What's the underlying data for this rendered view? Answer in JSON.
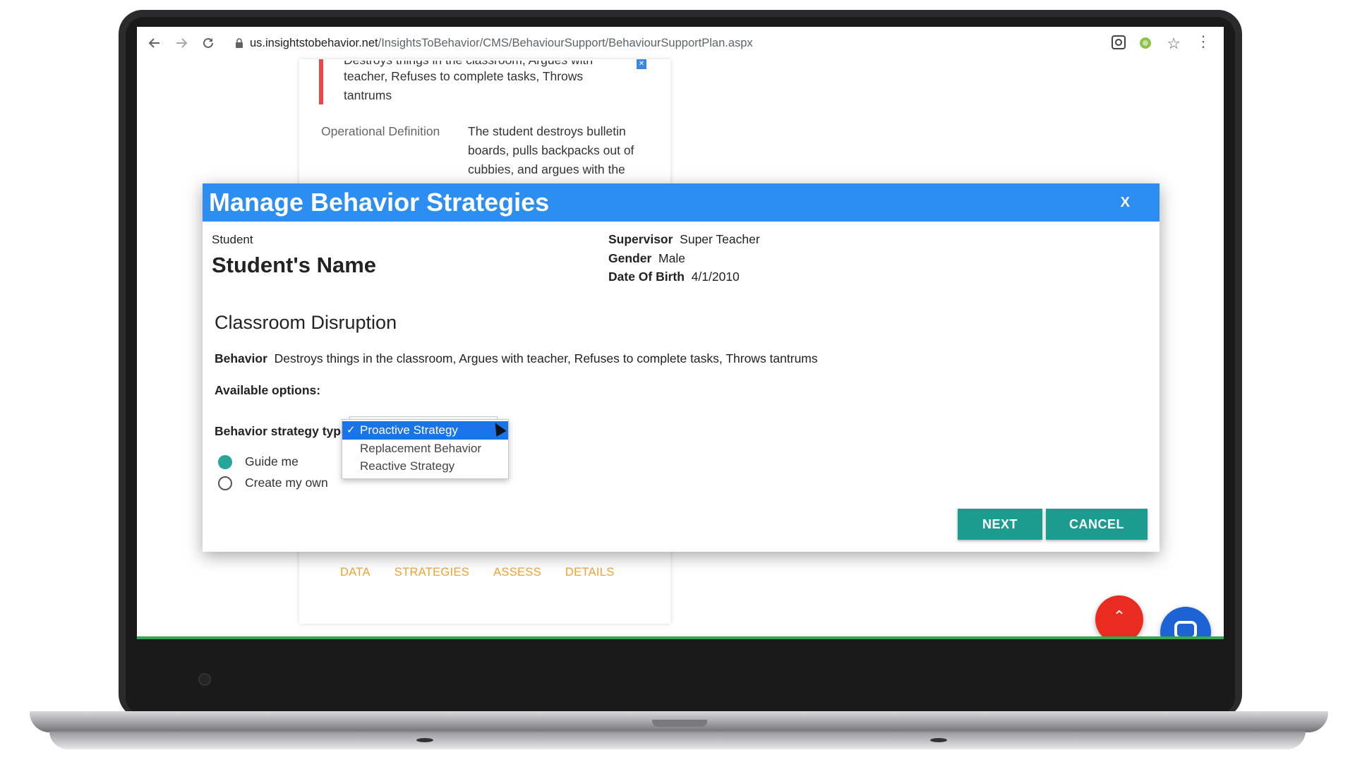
{
  "browser": {
    "url_host": "us.insightstobehavior.net",
    "url_path": "/InsightsToBehavior/CMS/BehaviourSupport/BehaviourSupportPlan.aspx"
  },
  "background_page": {
    "behavior_text_top": "Destroys things in the classroom, Argues with",
    "behavior_text_line2": "teacher, Refuses to complete tasks, Throws",
    "behavior_text_line3": "tantrums",
    "operational_definition_label": "Operational Definition",
    "operational_definition_line1": "The student destroys bulletin",
    "operational_definition_line2": "boards, pulls backpacks out of",
    "operational_definition_line3": "cubbies, and argues with the",
    "tabs": [
      "DATA",
      "STRATEGIES",
      "ASSESS",
      "DETAILS"
    ]
  },
  "modal": {
    "title": "Manage Behavior Strategies",
    "close_label": "X",
    "student_label": "Student",
    "student_name": "Student's Name",
    "supervisor_label": "Supervisor",
    "supervisor_value": "Super Teacher",
    "gender_label": "Gender",
    "gender_value": "Male",
    "dob_label": "Date Of Birth",
    "dob_value": "4/1/2010",
    "section_title": "Classroom Disruption",
    "behavior_label": "Behavior",
    "behavior_value": "Destroys things in the classroom, Argues with teacher, Refuses to complete tasks, Throws tantrums",
    "available_options_label": "Available options:",
    "strategy_type_label": "Behavior strategy type",
    "strategy_options": [
      {
        "label": "Proactive Strategy",
        "selected": true
      },
      {
        "label": "Replacement Behavior",
        "selected": false
      },
      {
        "label": "Reactive Strategy",
        "selected": false
      }
    ],
    "radio_options": [
      {
        "label": "Guide me",
        "checked": true
      },
      {
        "label": "Create my own",
        "checked": false
      }
    ],
    "next_label": "NEXT",
    "cancel_label": "CANCEL"
  },
  "colors": {
    "modal_header": "#2b8ef0",
    "button_teal": "#1b9c8e",
    "radio_checked": "#26a69a",
    "tab_orange": "#f0a430",
    "dropdown_selected": "#1a73e8"
  }
}
